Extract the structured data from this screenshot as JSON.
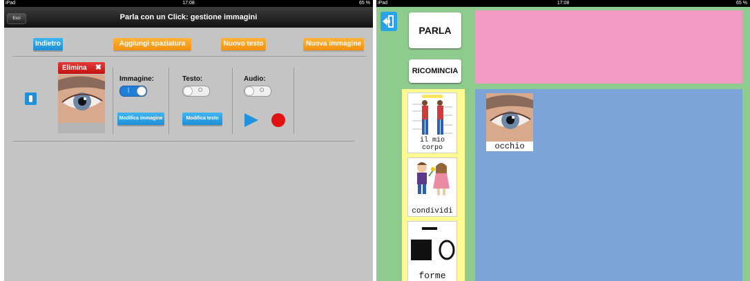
{
  "left_screen": {
    "status": {
      "device": "iPad",
      "time": "17:08",
      "battery": "65 %"
    },
    "nav": {
      "back_label": "Esci",
      "title": "Parla con un Click: gestione immagini"
    },
    "toolbar": {
      "back": "Indietro",
      "add_spacing": "Aggiungi spaziatura",
      "new_text": "Nuovo testo",
      "new_image": "Nuova immagine"
    },
    "item": {
      "delete_label": "Elimina",
      "image_label": "Immagine:",
      "text_label": "Testo:",
      "audio_label": "Audio:",
      "image_toggle": "on",
      "text_toggle": "off",
      "audio_toggle": "off",
      "edit_image": "Modifica immagine",
      "edit_text": "Modifica testo"
    },
    "colors": {
      "accent_blue": "#1e8fd8",
      "accent_orange": "#f3900e",
      "delete_red": "#d42020",
      "record_red": "#e01212"
    }
  },
  "right_screen": {
    "status": {
      "device": "iPad",
      "time": "17:08",
      "battery": "65 %"
    },
    "buttons": {
      "speak": "PARLA",
      "restart": "RICOMINCIA"
    },
    "categories": [
      {
        "label": "il mio corpo",
        "icon": "body-chart-icon"
      },
      {
        "label": "condividi",
        "icon": "children-sharing-icon"
      },
      {
        "label": "forme",
        "icon": "shapes-icon"
      }
    ],
    "selected_item": {
      "label": "occhio"
    },
    "colors": {
      "phrase_bar": "#f29ac1",
      "board": "#7ca4d6",
      "category_strip": "#fffb90",
      "background": "#8dcb8e"
    }
  }
}
